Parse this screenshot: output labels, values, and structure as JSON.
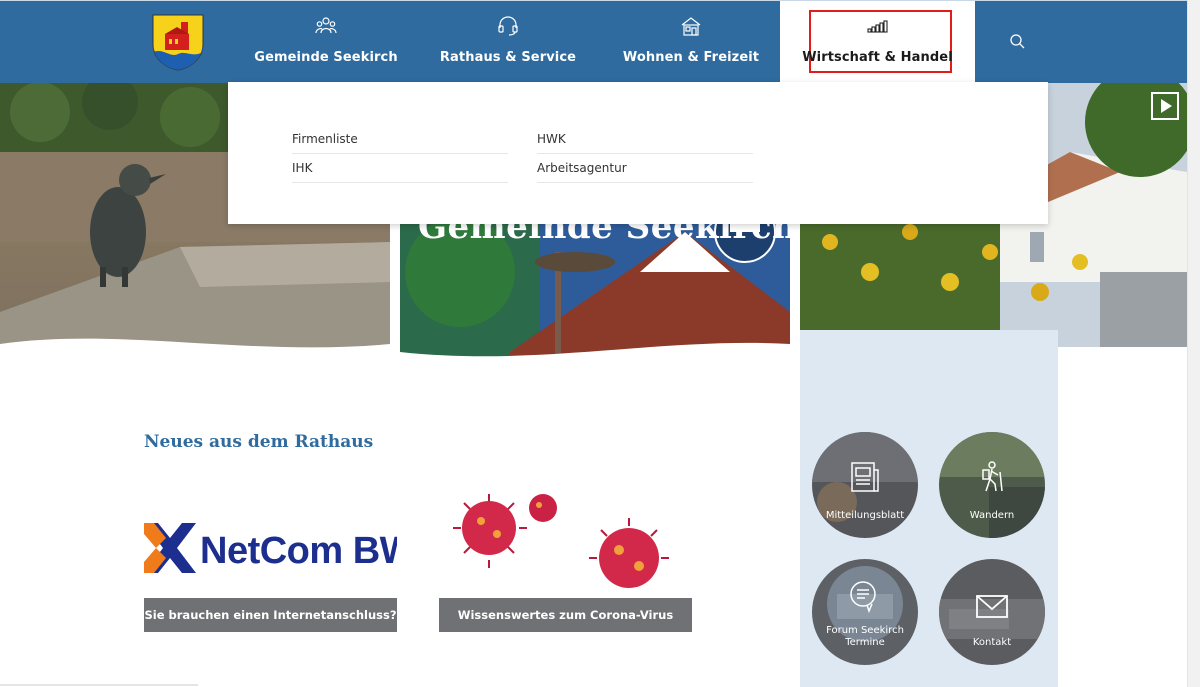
{
  "header": {
    "nav": [
      {
        "label": "Gemeinde Seekirch",
        "icon": "people-icon"
      },
      {
        "label": "Rathaus & Service",
        "icon": "headset-icon"
      },
      {
        "label": "Wohnen & Freizeit",
        "icon": "house-icon"
      },
      {
        "label": "Wirtschaft & Handel",
        "icon": "coins-chart-icon"
      }
    ],
    "search_icon": "search-icon"
  },
  "hero": {
    "title": "Gemeinde Seekirch"
  },
  "dropdown": {
    "links": [
      "Firmenliste",
      "IHK",
      "HWK",
      "Arbeitsagentur"
    ]
  },
  "news": {
    "title": "Neues aus dem Rathaus",
    "cards": [
      {
        "image_text": "NetCom BW",
        "caption": "Sie brauchen einen Internetanschluss?"
      },
      {
        "caption": "Wissenswertes zum Corona-Virus"
      }
    ]
  },
  "quicklinks": [
    {
      "label": "Mitteilungsblatt",
      "icon": "newspaper-icon"
    },
    {
      "label": "Wandern",
      "icon": "hiker-icon"
    },
    {
      "label": "Forum Seekirch Termine",
      "label_line1": "Forum Seekirch",
      "label_line2": "Termine",
      "icon": "chat-list-icon"
    },
    {
      "label": "Kontakt",
      "icon": "envelope-icon"
    }
  ],
  "colors": {
    "header_blue": "#2f6b9e",
    "highlight_red": "#e21b1b",
    "caption_gray": "#707174",
    "sidebar_blue": "#dde8f2"
  }
}
